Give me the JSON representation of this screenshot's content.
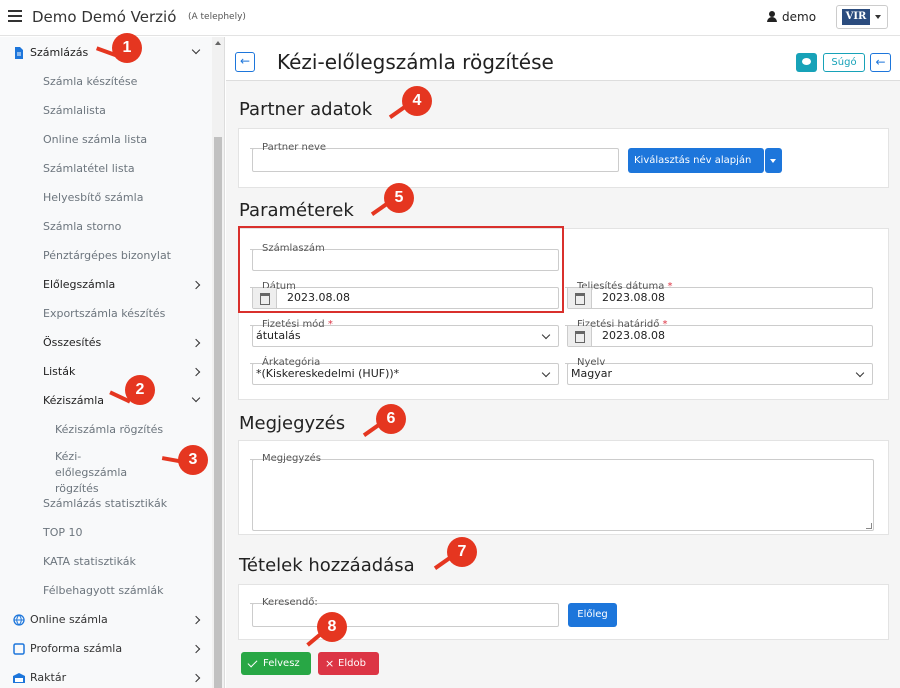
{
  "topbar": {
    "app_title": "Demo Demó Verzió",
    "app_sub": "(A telephely)",
    "user": "demo",
    "logo": "VIR"
  },
  "sidebar": {
    "items": [
      {
        "label": "Számlázás",
        "level": "top",
        "chevron": "down",
        "icon": "document-icon"
      },
      {
        "label": "Számla készítése",
        "level": "sub"
      },
      {
        "label": "Számlalista",
        "level": "sub"
      },
      {
        "label": "Online számla lista",
        "level": "sub"
      },
      {
        "label": "Számlatétel lista",
        "level": "sub"
      },
      {
        "label": "Helyesbítő számla",
        "level": "sub"
      },
      {
        "label": "Számla storno",
        "level": "sub"
      },
      {
        "label": "Pénztárgépes bizonylat",
        "level": "sub"
      },
      {
        "label": "Előlegszámla",
        "level": "subbold",
        "chevron": "right"
      },
      {
        "label": "Exportszámla készítés",
        "level": "sub"
      },
      {
        "label": "Összesítés",
        "level": "subbold",
        "chevron": "right"
      },
      {
        "label": "Listák",
        "level": "subbold",
        "chevron": "right"
      },
      {
        "label": "Kéziszámla",
        "level": "subbold",
        "chevron": "down"
      },
      {
        "label": "Kéziszámla rögzítés",
        "level": "subsub"
      },
      {
        "label": "Kézi-előlegszámla rögzítés",
        "level": "subsub2"
      },
      {
        "label": "Számlázás statisztikák",
        "level": "sub"
      },
      {
        "label": "TOP 10",
        "level": "sub"
      },
      {
        "label": "KATA statisztikák",
        "level": "sub"
      },
      {
        "label": "Félbehagyott számlák",
        "level": "sub"
      },
      {
        "label": "Online számla",
        "level": "top",
        "chevron": "right",
        "icon": "globe-icon"
      },
      {
        "label": "Proforma számla",
        "level": "top",
        "chevron": "right",
        "icon": "square-icon"
      },
      {
        "label": "Raktár",
        "level": "top",
        "chevron": "right",
        "icon": "building-icon"
      }
    ]
  },
  "page": {
    "title": "Kézi-előlegszámla rögzítése",
    "help": "Súgó"
  },
  "partner": {
    "section": "Partner adatok",
    "name_label": "Partner neve",
    "name_value": "",
    "select_btn": "Kiválasztás név alapján"
  },
  "params": {
    "section": "Paraméterek",
    "invoice_no_label": "Számlaszám",
    "invoice_no": "",
    "date_label": "Dátum",
    "date": "2023.08.08",
    "perf_label": "Teljesítés dátuma",
    "perf_date": "2023.08.08",
    "pay_mode_label": "Fizetési mód",
    "pay_mode": "átutalás",
    "due_label": "Fizetési határidő",
    "due_date": "2023.08.08",
    "price_cat_label": "Árkategória",
    "price_cat": "*(Kiskereskedelmi (HUF))*",
    "lang_label": "Nyelv",
    "lang": "Magyar"
  },
  "note": {
    "section": "Megjegyzés",
    "label": "Megjegyzés",
    "value": ""
  },
  "items": {
    "section": "Tételek hozzáadása",
    "search_label": "Keresendő:",
    "search_value": "",
    "advance_btn": "Előleg"
  },
  "actions": {
    "save": "Felvesz",
    "discard": "Eldob"
  },
  "markers": [
    "1",
    "2",
    "3",
    "4",
    "5",
    "6",
    "7",
    "8"
  ],
  "colors": {
    "primary": "#1d76db",
    "success": "#28a745",
    "danger": "#dc3545",
    "marker": "#e53620",
    "info": "#17a2b8"
  }
}
